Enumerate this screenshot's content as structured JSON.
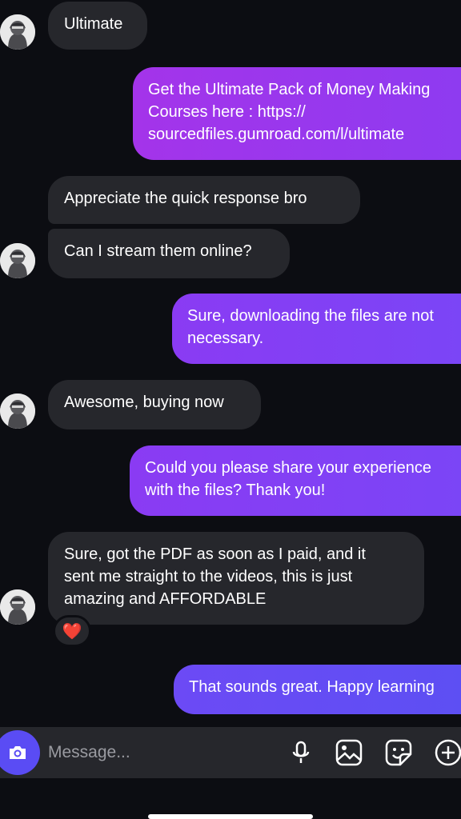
{
  "conversation": {
    "messages": [
      {
        "from": "them",
        "text": "Ultimate"
      },
      {
        "from": "me",
        "lines": [
          "Get the Ultimate Pack of Money Making",
          "Courses here : https://",
          "sourcedfiles.gumroad.com/l/ultimate"
        ]
      },
      {
        "from": "them",
        "text": "Appreciate the quick response bro"
      },
      {
        "from": "them",
        "text": "Can I stream them online?"
      },
      {
        "from": "me",
        "lines": [
          "Sure, downloading the files are not",
          "necessary."
        ]
      },
      {
        "from": "them",
        "text": "Awesome, buying now"
      },
      {
        "from": "me",
        "lines": [
          "Could you please share your experience",
          "with the files? Thank you!"
        ]
      },
      {
        "from": "them",
        "lines": [
          "Sure, got the PDF as soon as I paid, and it",
          "sent me straight to the videos, this is just",
          "amazing and AFFORDABLE"
        ]
      },
      {
        "from": "me",
        "text": "That sounds great. Happy learning"
      }
    ],
    "reaction": "❤️"
  },
  "composer": {
    "placeholder": "Message...",
    "icons": [
      "camera-icon",
      "microphone-icon",
      "gallery-icon",
      "sticker-icon",
      "plus-icon"
    ]
  },
  "colors": {
    "background": "#0c0d12",
    "incoming_bubble": "#26272c",
    "outgoing_top": "#a434ea",
    "outgoing_bottom": "#5d4ff3"
  }
}
